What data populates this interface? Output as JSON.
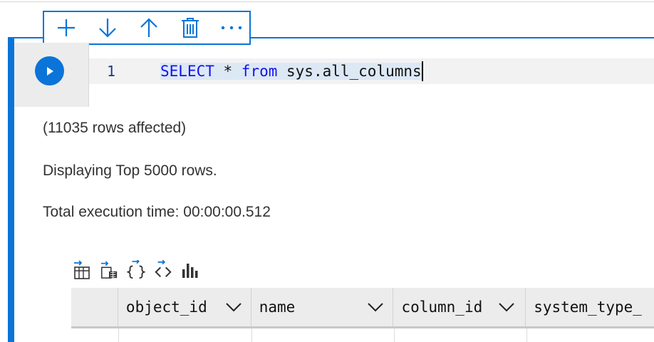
{
  "cell_toolbar": {
    "buttons": [
      {
        "name": "add-icon"
      },
      {
        "name": "move-down-icon"
      },
      {
        "name": "move-up-icon"
      },
      {
        "name": "delete-icon"
      },
      {
        "name": "more-icon"
      }
    ],
    "more_label": "···"
  },
  "editor": {
    "line_number": "1",
    "code": {
      "keyword1": "SELECT",
      "op": " * ",
      "keyword2": "from",
      "rest": " sys.all_columns"
    }
  },
  "messages": {
    "rows_affected": "(11035 rows affected)",
    "displaying": "Displaying Top 5000 rows.",
    "execution_time": "Total execution time: 00:00:00.512"
  },
  "result_toolbar": {
    "icons": [
      "save-csv-icon",
      "save-excel-icon",
      "save-json-icon",
      "save-xml-icon",
      "chart-icon"
    ]
  },
  "grid": {
    "columns": [
      {
        "label": "object_id"
      },
      {
        "label": "name"
      },
      {
        "label": "column_id"
      },
      {
        "label": "system_type_"
      }
    ]
  },
  "colors": {
    "accent": "#0a74d8",
    "keyword": "#1212ee"
  }
}
